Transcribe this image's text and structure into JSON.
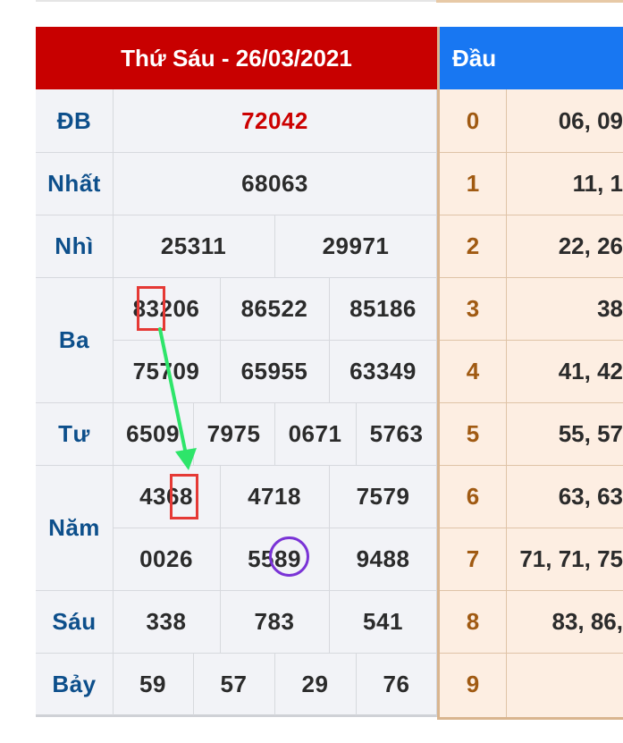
{
  "results": {
    "header": "Thứ Sáu - 26/03/2021",
    "rows": [
      {
        "label": "ĐB",
        "values": [
          "72042"
        ]
      },
      {
        "label": "Nhất",
        "values": [
          "68063"
        ]
      },
      {
        "label": "Nhì",
        "values": [
          "25311",
          "29971"
        ]
      },
      {
        "label": "Ba",
        "values": [
          "83206",
          "86522",
          "85186",
          "75709",
          "65955",
          "63349"
        ]
      },
      {
        "label": "Tư",
        "values": [
          "6509",
          "7975",
          "0671",
          "5763"
        ]
      },
      {
        "label": "Năm",
        "values": [
          "4368",
          "4718",
          "7579",
          "0026",
          "5589",
          "9488"
        ]
      },
      {
        "label": "Sáu",
        "values": [
          "338",
          "783",
          "541"
        ]
      },
      {
        "label": "Bảy",
        "values": [
          "59",
          "57",
          "29",
          "76"
        ]
      }
    ]
  },
  "loto": {
    "header": "Đầu",
    "rows": [
      {
        "digit": "0",
        "values": "06, 09"
      },
      {
        "digit": "1",
        "values": "11, 1"
      },
      {
        "digit": "2",
        "values": "22, 26"
      },
      {
        "digit": "3",
        "values": "38"
      },
      {
        "digit": "4",
        "values": "41, 42"
      },
      {
        "digit": "5",
        "values": "55, 57"
      },
      {
        "digit": "6",
        "values": "63, 63"
      },
      {
        "digit": "7",
        "values": "71, 71, 75"
      },
      {
        "digit": "8",
        "values": "83, 86,"
      },
      {
        "digit": "9",
        "values": ""
      }
    ]
  },
  "annotations": {
    "marker_color": "#e53935",
    "arrow_color": "#2ee56a",
    "circle_color": "#7a33d6"
  }
}
